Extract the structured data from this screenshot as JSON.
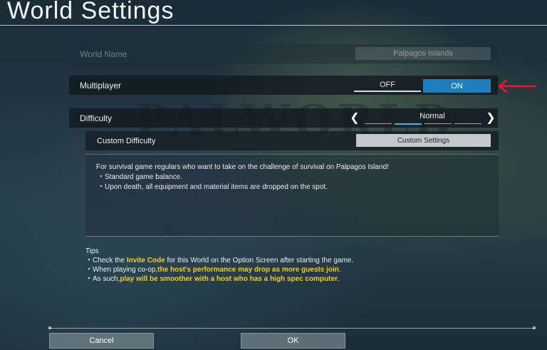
{
  "screen": {
    "title": "World Settings"
  },
  "world_name": {
    "label": "World Name",
    "value": "Palpagos Islands"
  },
  "multiplayer": {
    "label": "Multiplayer",
    "off_label": "OFF",
    "on_label": "ON",
    "selected": "ON"
  },
  "difficulty": {
    "label": "Difficulty",
    "value": "Normal",
    "levels": 4,
    "active_level": 2
  },
  "custom_difficulty": {
    "label": "Custom Difficulty",
    "button_label": "Custom Settings"
  },
  "description": {
    "text": "For survival game regulars who want to take on the challenge of survival on Palpagos Island!",
    "bullets": [
      "・Standard game balance.",
      "・Upon death, all equipment and material items are dropped on the spot."
    ]
  },
  "tips": {
    "heading": "Tips",
    "line1_a": "・Check the ",
    "line1_hl": "Invite Code",
    "line1_b": " for this World on the Option Screen after starting the game.",
    "line2_a": "・When playing co-op,",
    "line2_hl": "the host's performance may drop as more guests join",
    "line2_b": ".",
    "line3_a": "・As such,",
    "line3_hl": "play will be smoother with a host who has a high spec computer",
    "line3_b": "."
  },
  "footer": {
    "cancel_label": "Cancel",
    "ok_label": "OK"
  },
  "background_watermark": "PALWORLD",
  "colors": {
    "accent": "#1e7fbf",
    "highlight": "#f5cb2b",
    "annotation_arrow": "#d9232e"
  },
  "icons": {
    "prev": "chevron-left-icon",
    "next": "chevron-right-icon",
    "annotation": "red-arrow-icon"
  }
}
